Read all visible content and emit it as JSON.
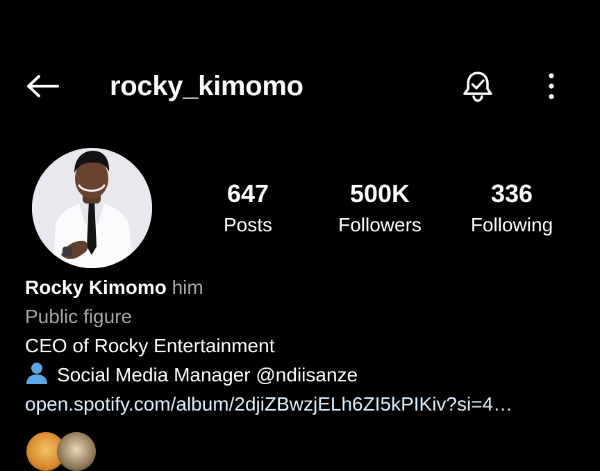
{
  "header": {
    "username": "rocky_kimomo",
    "back_icon": "arrow-left-icon",
    "bell_icon": "bell-check-icon",
    "more_icon": "vertical-ellipsis-icon"
  },
  "stats": {
    "posts": {
      "count": "647",
      "label": "Posts"
    },
    "followers": {
      "count": "500K",
      "label": "Followers"
    },
    "following": {
      "count": "336",
      "label": "Following"
    }
  },
  "bio": {
    "full_name": "Rocky Kimomo",
    "pronouns": "him",
    "category": "Public figure",
    "line1": "CEO of Rocky Entertainment",
    "line2": "Social Media Manager @ndiisanze",
    "line2_icon": "person-silhouette-icon",
    "link": "open.spotify.com/album/2djiZBwzjELh6ZI5kPIKiv?si=4…"
  },
  "colors": {
    "background": "#000000",
    "text": "#ffffff",
    "secondary_text": "#a8a8a8",
    "link": "#e0f1ff",
    "person_icon": "#5aa9e6"
  }
}
